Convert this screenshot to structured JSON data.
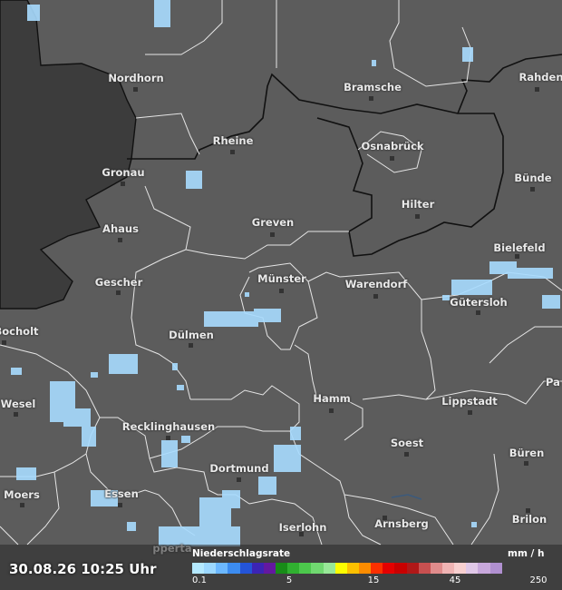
{
  "timestamp": "30.08.26 10:25 Uhr",
  "legend": {
    "title": "Niederschlagsrate",
    "unit": "mm / h",
    "ticks": [
      "0.1",
      "5",
      "15",
      "45",
      "250"
    ],
    "colors": [
      "#b4e9ff",
      "#9cd8ff",
      "#6cb8ff",
      "#3c8cf0",
      "#2454d8",
      "#3c24b4",
      "#6418a0",
      "#188c18",
      "#30b030",
      "#4cc84c",
      "#70d870",
      "#98e898",
      "#fcfc00",
      "#fcc000",
      "#fc8c00",
      "#fc3000",
      "#e40000",
      "#c80000",
      "#b01818",
      "#c85050",
      "#e08c8c",
      "#f0b4b4",
      "#f8d0d0",
      "#e0c8e8",
      "#c8a8dc",
      "#b090d0"
    ]
  },
  "cities": [
    {
      "name": "Nordhorn",
      "id": "nordhorn"
    },
    {
      "name": "Bramsche",
      "id": "bramsche"
    },
    {
      "name": "Rahden",
      "id": "rahden"
    },
    {
      "name": "Rheine",
      "id": "rheine"
    },
    {
      "name": "Osnabrück",
      "id": "osnabrueck"
    },
    {
      "name": "Gronau",
      "id": "gronau"
    },
    {
      "name": "Bünde",
      "id": "buende"
    },
    {
      "name": "Hilter",
      "id": "hilter"
    },
    {
      "name": "Ahaus",
      "id": "ahaus"
    },
    {
      "name": "Greven",
      "id": "greven"
    },
    {
      "name": "Bielefeld",
      "id": "bielefeld"
    },
    {
      "name": "Gescher",
      "id": "gescher"
    },
    {
      "name": "Münster",
      "id": "muenster"
    },
    {
      "name": "Warendorf",
      "id": "warendorf"
    },
    {
      "name": "Gütersloh",
      "id": "guetersloh"
    },
    {
      "name": "Bocholt",
      "id": "bocholt"
    },
    {
      "name": "Dülmen",
      "id": "duelmen"
    },
    {
      "name": "Pa",
      "id": "paderborn"
    },
    {
      "name": "Wesel",
      "id": "wesel"
    },
    {
      "name": "Hamm",
      "id": "hamm"
    },
    {
      "name": "Lippstadt",
      "id": "lippstadt"
    },
    {
      "name": "Recklinghausen",
      "id": "recklinghausen"
    },
    {
      "name": "Soest",
      "id": "soest"
    },
    {
      "name": "Büren",
      "id": "bueren"
    },
    {
      "name": "Dortmund",
      "id": "dortmund"
    },
    {
      "name": "Moers",
      "id": "moers"
    },
    {
      "name": "Essen",
      "id": "essen"
    },
    {
      "name": "Iserlohn",
      "id": "iserlohn"
    },
    {
      "name": "Arnsberg",
      "id": "arnsberg"
    },
    {
      "name": "Brilon",
      "id": "brilon"
    },
    {
      "name": "pperta",
      "id": "wuppertal"
    }
  ]
}
